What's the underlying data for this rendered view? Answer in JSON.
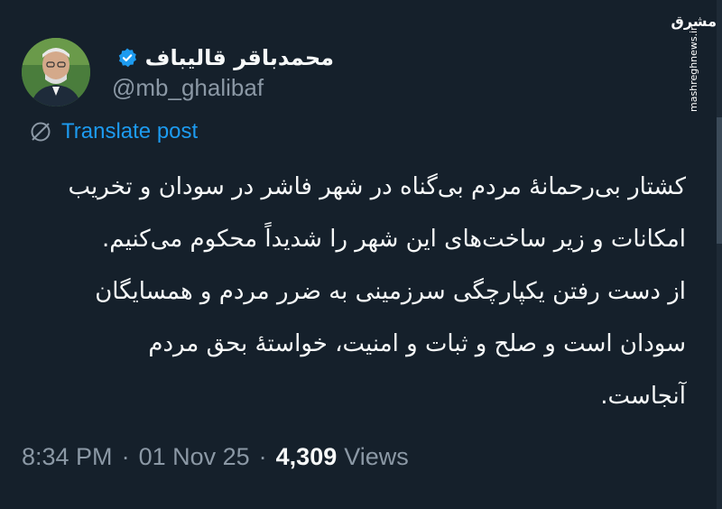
{
  "author": {
    "display_name": "محمدباقر قالیباف",
    "handle": "@mb_ghalibaf",
    "verified": true,
    "avatar_icon": "profile-photo"
  },
  "translate": {
    "label": "Translate post",
    "icon": "globe-slash-icon"
  },
  "post": {
    "lines": [
      "کشتار بی‌رحمانهٔ مردم بی‌گناه در شهر فاشر در سودان و تخریب",
      "امکانات و زیر ساخت‌های این شهر را شدیداً محکوم می‌کنیم.",
      "از دست رفتن یکپارچگی سرزمینی به ضرر مردم و همسایگان",
      "سودان است و صلح و ثبات و امنیت، خواستهٔ بحق مردم",
      "آنجاست."
    ]
  },
  "meta": {
    "time": "8:34 PM",
    "date": "01 Nov 25",
    "separator": "·",
    "views_count": "4,309",
    "views_label": "Views"
  },
  "watermark": {
    "logo": "مشرق",
    "site": "mashreghnews.ir"
  },
  "colors": {
    "background": "#15202b",
    "text": "#f7f9f9",
    "secondary": "#8b98a5",
    "accent": "#1d9bf0"
  }
}
